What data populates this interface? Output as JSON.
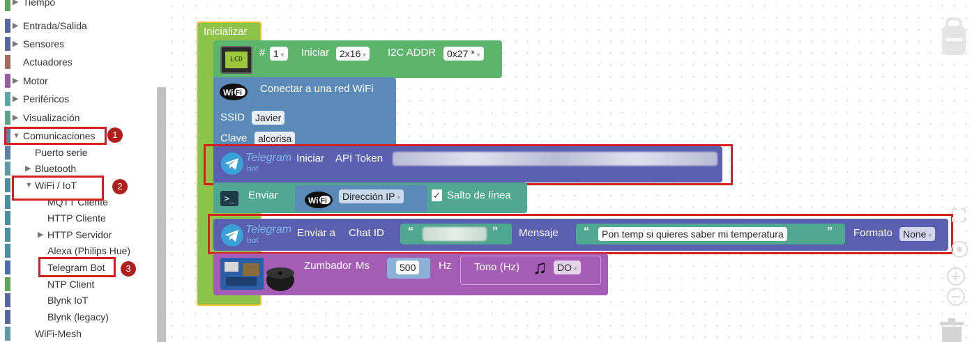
{
  "sidebar": {
    "categories": [
      {
        "label": "Tiempo",
        "color": "#5ba55b",
        "has_arrow": true
      },
      {
        "label": "Entrada/Salida",
        "color": "#5b67a5",
        "has_arrow": true
      },
      {
        "label": "Sensores",
        "color": "#5b67a5",
        "has_arrow": true
      },
      {
        "label": "Actuadores",
        "color": "#a56b5b",
        "has_arrow": false
      },
      {
        "label": "Motor",
        "color": "#9a5ba5",
        "has_arrow": true
      },
      {
        "label": "Periféricos",
        "color": "#5ba5a5",
        "has_arrow": true
      },
      {
        "label": "Visualización",
        "color": "#5ba58c",
        "has_arrow": true
      },
      {
        "label": "Comunicaciones",
        "color": "#5b80a5",
        "has_arrow": true
      }
    ],
    "comm_children": [
      {
        "label": "Puerto serie"
      },
      {
        "label": "Bluetooth"
      },
      {
        "label": "WiFi / IoT"
      },
      {
        "label": "MQTT Cliente"
      },
      {
        "label": "HTTP Cliente"
      },
      {
        "label": "HTTP Servidor"
      },
      {
        "label": "Alexa (Philips Hue)"
      },
      {
        "label": "Telegram Bot"
      },
      {
        "label": "NTP Client"
      },
      {
        "label": "Blynk IoT"
      },
      {
        "label": "Blynk (legacy)"
      },
      {
        "label": "WiFi-Mesh"
      }
    ]
  },
  "badges": [
    "1",
    "2",
    "3"
  ],
  "blocks": {
    "init": {
      "label": "Inicializar"
    },
    "lcd": {
      "icon_text": "LCD",
      "hash": "#",
      "num": "1",
      "iniciar": "Iniciar",
      "size": "2x16",
      "i2c": "I2C ADDR",
      "addr": "0x27 *"
    },
    "wifi_connect": {
      "title": "Conectar a una red WiFi",
      "ssid_label": "SSID",
      "ssid": "Javier",
      "clave_label": "Clave",
      "clave": "alcorisa"
    },
    "telegram_init": {
      "logo_main": "Telegram",
      "logo_sub": "bot",
      "iniciar": "Iniciar",
      "api": "API Token"
    },
    "enviar": {
      "label": "Enviar",
      "prompt": ">_",
      "ip": "Dirección IP",
      "salto": "Salto de línea"
    },
    "telegram_send": {
      "logo_main": "Telegram",
      "logo_sub": "bot",
      "enviar_a": "Enviar a",
      "chat": "Chat ID",
      "mensaje": "Mensaje",
      "msg": "Pon temp si quieres saber mi temperatura",
      "formato": "Formato",
      "format_val": "None"
    },
    "zumbador": {
      "label": "Zumbador",
      "ms": "Ms",
      "ms_val": "500",
      "hz": "Hz",
      "tono": "Tono (Hz)",
      "note": "DO"
    }
  },
  "colors": {
    "init": "#8ec34a",
    "lcd": "#5cb56a",
    "wifi": "#5b8ab8",
    "telegram": "#5a5fb0",
    "enviar": "#4fa88f",
    "zumbador": "#a45cb5",
    "highlight": "#d62020"
  }
}
